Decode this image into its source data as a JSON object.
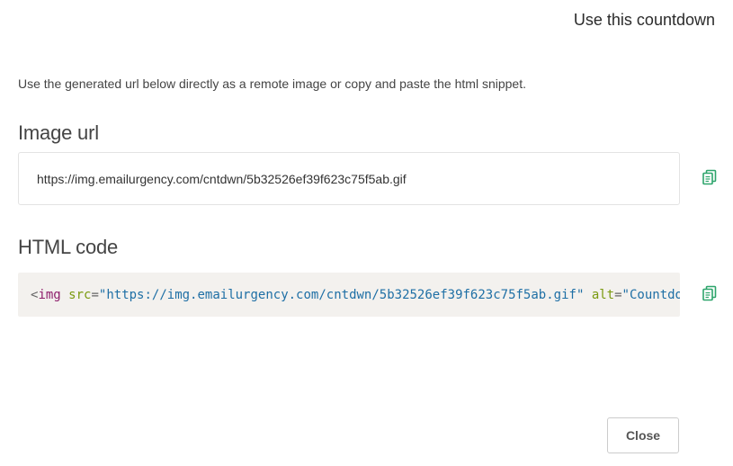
{
  "modal": {
    "title": "Use this countdown",
    "intro": "Use the generated url below directly as a remote image or copy and paste the html snippet."
  },
  "image_url": {
    "heading": "Image url",
    "value": "https://img.emailurgency.com/cntdwn/5b32526ef39f623c75f5ab.gif",
    "copy_icon": "copy-icon"
  },
  "html_code": {
    "heading": "HTML code",
    "open_bracket": "<",
    "tag": "img",
    "attr_src": "src",
    "equals": "=",
    "quote": "\"",
    "src_value": "https://img.emailurgency.com/cntdwn/5b32526ef39f623c75f5ab.gif",
    "attr_alt": "alt",
    "alt_value": "Countdo",
    "copy_icon": "copy-icon"
  },
  "footer": {
    "close_label": "Close"
  },
  "colors": {
    "accent_green": "#2ea56c",
    "code_background": "#f3f1ee",
    "tag": "#8e1f6b",
    "attribute": "#7a9a0f",
    "string": "#1e6fa5"
  }
}
